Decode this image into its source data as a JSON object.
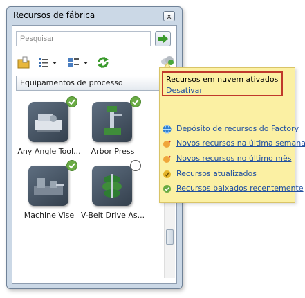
{
  "window": {
    "title": "Recursos de fábrica",
    "close_glyph": "x"
  },
  "search": {
    "placeholder": "Pesquisar"
  },
  "dropdown": {
    "selected": "Equipamentos de processo"
  },
  "items": [
    {
      "label": "Any Angle Tool...",
      "checked": true
    },
    {
      "label": "Arbor Press",
      "checked": true
    },
    {
      "label": "Machine Vise",
      "checked": true
    },
    {
      "label": "V-Belt Drive As...",
      "checked": false
    }
  ],
  "popup": {
    "notice": "Recursos em nuvem ativados",
    "disable_link": "Desativar",
    "links": [
      {
        "label": "Depósito de recursos do Factory",
        "icon": "globe-icon"
      },
      {
        "label": "Novos recursos na última semana",
        "icon": "new-badge-icon"
      },
      {
        "label": "Novos recursos no último mês",
        "icon": "new-badge-icon"
      },
      {
        "label": "Recursos atualizados",
        "icon": "update-icon"
      },
      {
        "label": "Recursos baixados recentemente",
        "icon": "download-check-icon"
      }
    ]
  },
  "colors": {
    "accent_link": "#1f4fa0",
    "popup_bg": "#fbf0a3",
    "check_green": "#6aab44",
    "notice_border": "#c0392b"
  }
}
